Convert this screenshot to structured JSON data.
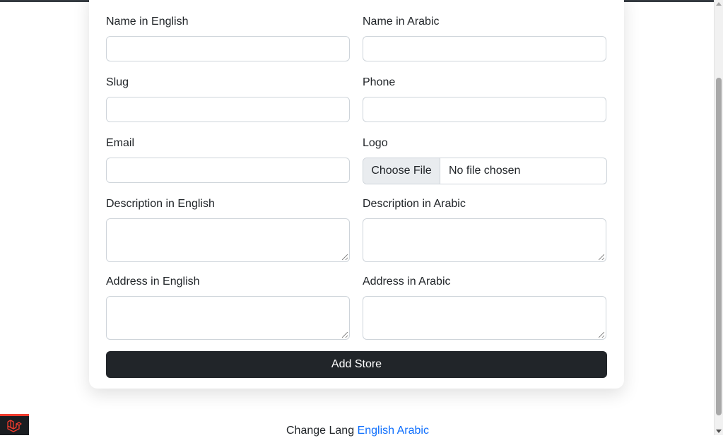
{
  "form": {
    "name_en": {
      "label": "Name in English",
      "value": ""
    },
    "name_ar": {
      "label": "Name in Arabic",
      "value": ""
    },
    "slug": {
      "label": "Slug",
      "value": ""
    },
    "phone": {
      "label": "Phone",
      "value": ""
    },
    "email": {
      "label": "Email",
      "value": ""
    },
    "logo": {
      "label": "Logo",
      "button_label": "Choose File",
      "status": "No file chosen"
    },
    "description_en": {
      "label": "Description in English",
      "value": ""
    },
    "description_ar": {
      "label": "Description in Arabic",
      "value": ""
    },
    "address_en": {
      "label": "Address in English",
      "value": ""
    },
    "address_ar": {
      "label": "Address in Arabic",
      "value": ""
    },
    "submit_label": "Add Store"
  },
  "footer": {
    "prefix": "Change Lang",
    "lang_english": "English",
    "lang_arabic": "Arabic"
  },
  "colors": {
    "primary_button": "#212529",
    "link": "#0d6efd",
    "laravel_badge": "#ef3b2d"
  },
  "icons": {
    "laravel_badge": "laravel-logo-icon"
  }
}
